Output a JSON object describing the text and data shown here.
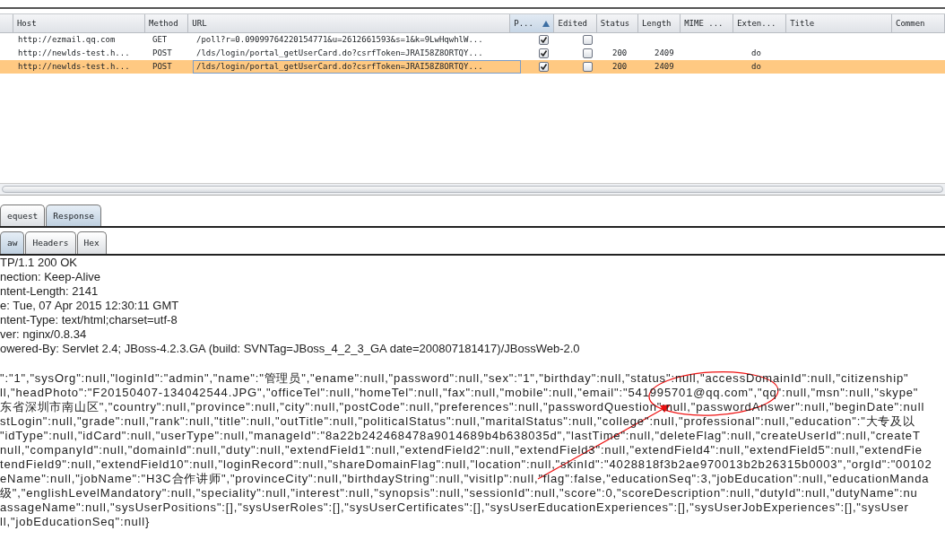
{
  "table": {
    "columns": [
      {
        "label": "Host",
        "sorted": false
      },
      {
        "label": "Method",
        "sorted": false
      },
      {
        "label": "URL",
        "sorted": false
      },
      {
        "label": "P...",
        "sorted": true
      },
      {
        "label": "Edited",
        "sorted": false
      },
      {
        "label": "Status",
        "sorted": false
      },
      {
        "label": "Length",
        "sorted": false
      },
      {
        "label": "MIME ...",
        "sorted": false
      },
      {
        "label": "Exten...",
        "sorted": false
      },
      {
        "label": "Title",
        "sorted": false
      },
      {
        "label": "Commen",
        "sorted": false
      }
    ],
    "rows": [
      {
        "host": "http://ezmail.qq.com",
        "method": "GET",
        "url": "/poll?r=0.09099764220154771&u=2612661593&s=1&k=9LwHqwhlW...",
        "params": true,
        "edited": false,
        "status": "",
        "length": "",
        "extension": "",
        "selected": false
      },
      {
        "host": "http://newlds-test.h...",
        "method": "POST",
        "url": "/lds/login/portal_getUserCard.do?csrfToken=JRAI58Z8ORTQY...",
        "params": true,
        "edited": false,
        "status": "200",
        "length": "2409",
        "extension": "do",
        "selected": false
      },
      {
        "host": "http://newlds-test.h...",
        "method": "POST",
        "url": "/lds/login/portal_getUserCard.do?csrfToken=JRAI58Z8ORTQY...",
        "params": true,
        "edited": false,
        "status": "200",
        "length": "2409",
        "extension": "do",
        "selected": true
      }
    ]
  },
  "message_tabs": [
    {
      "label": "equest",
      "selected": false
    },
    {
      "label": "Response",
      "selected": true
    }
  ],
  "view_tabs": [
    {
      "label": "aw",
      "selected": true
    },
    {
      "label": "Headers",
      "selected": false
    },
    {
      "label": "Hex",
      "selected": false
    }
  ],
  "headers": [
    "TP/1.1 200 OK",
    "nection: Keep-Alive",
    "ntent-Length: 2141",
    "e: Tue, 07 Apr 2015 12:30:11 GMT",
    "ntent-Type: text/html;charset=utf-8",
    "ver: nginx/0.8.34",
    "owered-By: Servlet 2.4; JBoss-4.2.3.GA (build: SVNTag=JBoss_4_2_3_GA date=200807181417)/JBossWeb-2.0"
  ],
  "body": [
    "\":\"1\",\"sysOrg\":null,\"loginId\":\"admin\",\"name\":\"管理员\",\"ename\":null,\"password\":null,\"sex\":\"1\",\"birthday\":null,\"status\":null,\"accessDomainId\":null,\"citizenship\"",
    "ll,\"headPhoto\":\"F20150407-134042544.JPG\",\"officeTel\":null,\"homeTel\":null,\"fax\":null,\"mobile\":null,\"email\":\"541995701@qq.com\",\"qq\":null,\"msn\":null,\"skype\"",
    "东省深圳市南山区\",\"country\":null,\"province\":null,\"city\":null,\"postCode\":null,\"preferences\":null,\"passwordQuestion\":null,\"passwordAnswer\":null,\"beginDate\":null",
    "stLogin\":null,\"grade\":null,\"rank\":null,\"title\":null,\"outTitle\":null,\"politicalStatus\":null,\"maritalStatus\":null,\"college\":null,\"professional\":null,\"education\":\"大专及以",
    "\"idType\":null,\"idCard\":null,\"userType\":null,\"manageId\":\"8a22b242468478a9014689b4b638035d\",\"lastTime\":null,\"deleteFlag\":null,\"createUserId\":null,\"createT",
    "null,\"companyId\":null,\"domainId\":null,\"duty\":null,\"extendField1\":null,\"extendField2\":null,\"extendField3\":null,\"extendField4\":null,\"extendField5\":null,\"extendFie",
    "tendField9\":null,\"extendField10\":null,\"loginRecord\":null,\"shareDomainFlag\":null,\"location\":null,\"skinId\":\"4028818f3b2ae970013b2b26315b0003\",\"orgId\":\"00102",
    "eName\":null,\"jobName\":\"H3C合作讲师\",\"provinceCity\":null,\"birthdayString\":null,\"visitIp\":null,\"flag\":false,\"educationSeq\":3,\"jobEducation\":null,\"educationManda",
    "级\",\"englishLevelMandatory\":null,\"speciality\":null,\"interest\":null,\"synopsis\":null,\"sessionId\":null,\"score\":0,\"scoreDescription\":null,\"dutyId\":null,\"dutyName\":nu",
    "assageName\":null,\"sysUserPositions\":[],\"sysUserRoles\":[],\"sysUserCertificates\":[],\"sysUserEducationExperiences\":[],\"sysUserJobExperiences\":[],\"sysUser",
    "ll,\"jobEducationSeq\":null}"
  ]
}
